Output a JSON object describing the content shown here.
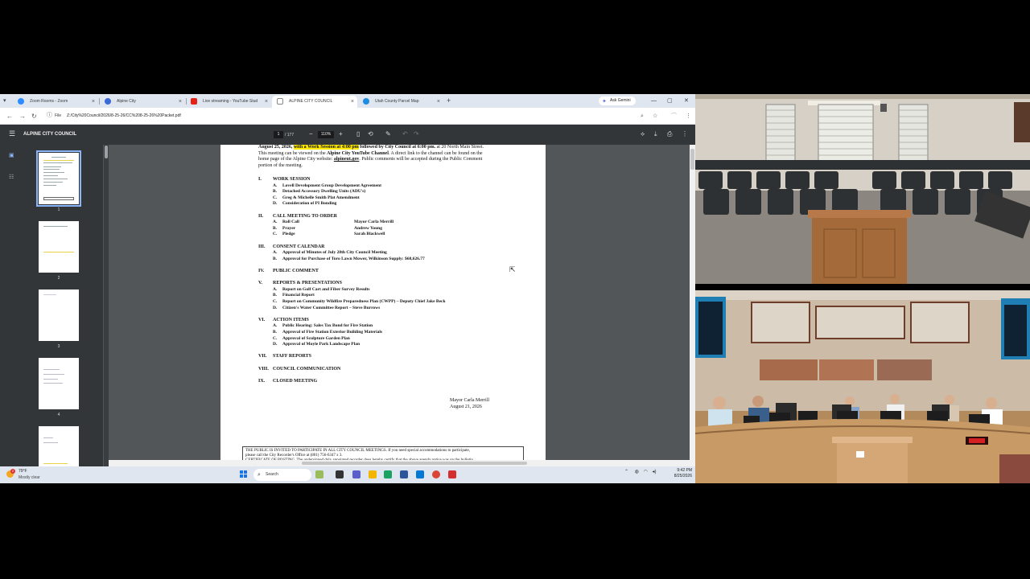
{
  "browser": {
    "tabs": [
      {
        "label": "Zoom Rooms - Zoom",
        "icon": "zoom-icon",
        "color": "#2d8cff",
        "active": false
      },
      {
        "label": "Alpine City",
        "icon": "alpine-city-icon",
        "color": "#3c6bd6",
        "active": false
      },
      {
        "label": "Live streaming - YouTube Studio",
        "icon": "youtube-icon",
        "color": "#e62117",
        "active": false
      },
      {
        "label": "ALPINE CITY COUNCIL",
        "icon": "pdf-icon",
        "color": "#666666",
        "active": true
      },
      {
        "label": "Utah County Parcel Map",
        "icon": "map-icon",
        "color": "#1c8de0",
        "active": false
      }
    ],
    "ask_gemini": "Ask Gemini",
    "address": {
      "scheme_label": "File",
      "url": "Z:/City%20Council/2026/8-25-26/CC%208-25-26%20Packet.pdf"
    }
  },
  "pdf_viewer": {
    "title": "ALPINE CITY COUNCIL",
    "current_page": "1",
    "total_pages": "/ 177",
    "zoom": "110%",
    "thumbnails": [
      "1",
      "2",
      "3",
      "4"
    ]
  },
  "document": {
    "intro": {
      "line1_date": "August 25, 2026,",
      "line1_highlight": "with a Work Session at 4:00 pm",
      "line1_mid": "followed by City Council at 6:00 pm.",
      "line1_end": "at 20 North Main Street.",
      "line2_start": "This meeting can be viewed on the",
      "line2_bold": "Alpine City YouTube Channel",
      "line2_end": ". A direct link to the channel can be found on the",
      "line3_start": "home page of the Alpine City website:",
      "line3_link": "alpineut.gov",
      "line3_end": ". Public comments will be accepted during the Public Comment",
      "line4": "portion of the meeting."
    },
    "sections": [
      {
        "num": "I.",
        "title": "WORK SESSION",
        "items": [
          {
            "letter": "A.",
            "text": "Lovell Development Group Development Agreement",
            "person": ""
          },
          {
            "letter": "B.",
            "text": "Detached Accessory Dwelling Units (ADU's)",
            "person": ""
          },
          {
            "letter": "C.",
            "text": "Greg & Michelle Smith Plat Amendment",
            "person": ""
          },
          {
            "letter": "D.",
            "text": "Consideration of PI Bonding",
            "person": ""
          }
        ]
      },
      {
        "num": "II.",
        "title": "CALL MEETING TO ORDER",
        "items": [
          {
            "letter": "A.",
            "text": "Roll Call",
            "person": "Mayor Carla Merrill"
          },
          {
            "letter": "B.",
            "text": "Prayer",
            "person": "Andrew Young"
          },
          {
            "letter": "C.",
            "text": "Pledge",
            "person": "Sarah Blackwell"
          }
        ]
      },
      {
        "num": "III.",
        "title": "CONSENT CALENDAR",
        "items": [
          {
            "letter": "A.",
            "text": "Approval of Minutes of July 28th City Council Meeting",
            "person": ""
          },
          {
            "letter": "B.",
            "text": "Approval for Purchase of Toro Lawn Mower, Wilkinson Supply: $68,626.77",
            "person": ""
          }
        ]
      },
      {
        "num": "IV.",
        "title": "PUBLIC COMMENT",
        "items": []
      },
      {
        "num": "V.",
        "title": "REPORTS & PRESENTATIONS",
        "items": [
          {
            "letter": "A.",
            "text": "Report on Golf Cart and Fiber Survey Results",
            "person": ""
          },
          {
            "letter": "B.",
            "text": "Financial Report",
            "person": ""
          },
          {
            "letter": "C.",
            "text": "Report on Community Wildfire Preparedness Plan (CWPP) – Deputy Chief Jake Beck",
            "person": ""
          },
          {
            "letter": "D.",
            "text": "Citizen's Water Committee Report – Steve Burrows",
            "person": ""
          }
        ]
      },
      {
        "num": "VI.",
        "title": "ACTION ITEMS",
        "items": [
          {
            "letter": "A.",
            "text": "Public Hearing: Sales Tax Bond for Fire Station",
            "person": ""
          },
          {
            "letter": "B.",
            "text": "Approval of Fire Station Exterior Building Materials",
            "person": ""
          },
          {
            "letter": "C.",
            "text": "Approval of Sculpture Garden Plan",
            "person": ""
          },
          {
            "letter": "D.",
            "text": "Approval of Moyle Park Landscape Plan",
            "person": ""
          }
        ]
      },
      {
        "num": "VII.",
        "title": "STAFF REPORTS",
        "items": []
      },
      {
        "num": "VIII.",
        "title": "COUNCIL COMMUNICATION",
        "items": []
      },
      {
        "num": "IX.",
        "title": "CLOSED MEETING",
        "items": []
      }
    ],
    "signature_name": "Mayor Carla Merrill",
    "signature_date": "August 21, 2026",
    "notice_line1": "THE PUBLIC IS INVITED TO PARTICIPATE IN ALL CITY COUNCIL MEETINGS.  If you need special accommodations to participate,",
    "notice_line2": "please call the City Recorder's Office at (801) 756-6347 x 3.",
    "notice_line3": "CERTIFICATE OF POSTING.  The undersigned duly appointed recorder does hereby certify that the above agenda notice was on the bulletin"
  },
  "taskbar": {
    "weather_temp": "79°F",
    "weather_desc": "Mostly clear",
    "notification_count": "2",
    "search_placeholder": "Search",
    "time": "9:42 PM",
    "date": "8/25/2026"
  }
}
